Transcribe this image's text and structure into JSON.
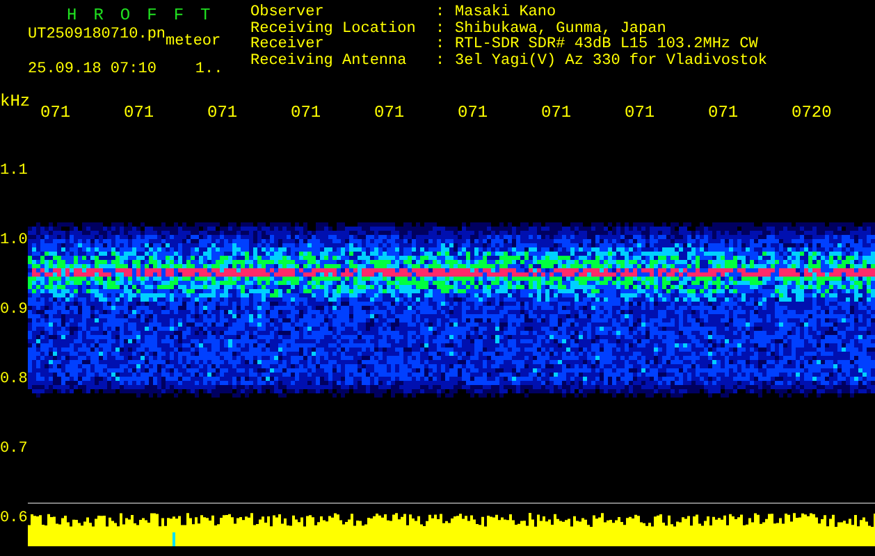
{
  "app": {
    "title_letters": [
      "H",
      "R",
      "O",
      "F",
      "F",
      "T"
    ],
    "file_name": "UT2509180710.pn",
    "mode": "meteor",
    "timestamp": "25.09.18 07:10",
    "counter": "1.."
  },
  "station": [
    {
      "label": "Observer",
      "separator": ":",
      "value": "Masaki Kano"
    },
    {
      "label": "Receiving Location",
      "separator": ":",
      "value": "Shibukawa, Gunma, Japan"
    },
    {
      "label": "Receiver",
      "separator": ":",
      "value": "RTL-SDR SDR# 43dB L15 103.2MHz CW"
    },
    {
      "label": "Receiving Antenna",
      "separator": ":",
      "value": "3el Yagi(V) Az 330 for Vladivostok"
    }
  ],
  "time_axis": {
    "unit": "kHz",
    "ticks": [
      "071",
      "071",
      "071",
      "071",
      "071",
      "071",
      "071",
      "071",
      "071",
      "0720"
    ]
  },
  "frequency_axis": {
    "ticks": [
      "1.1",
      "1.0",
      "0.9",
      "0.8",
      "0.7",
      "0.6"
    ]
  }
}
